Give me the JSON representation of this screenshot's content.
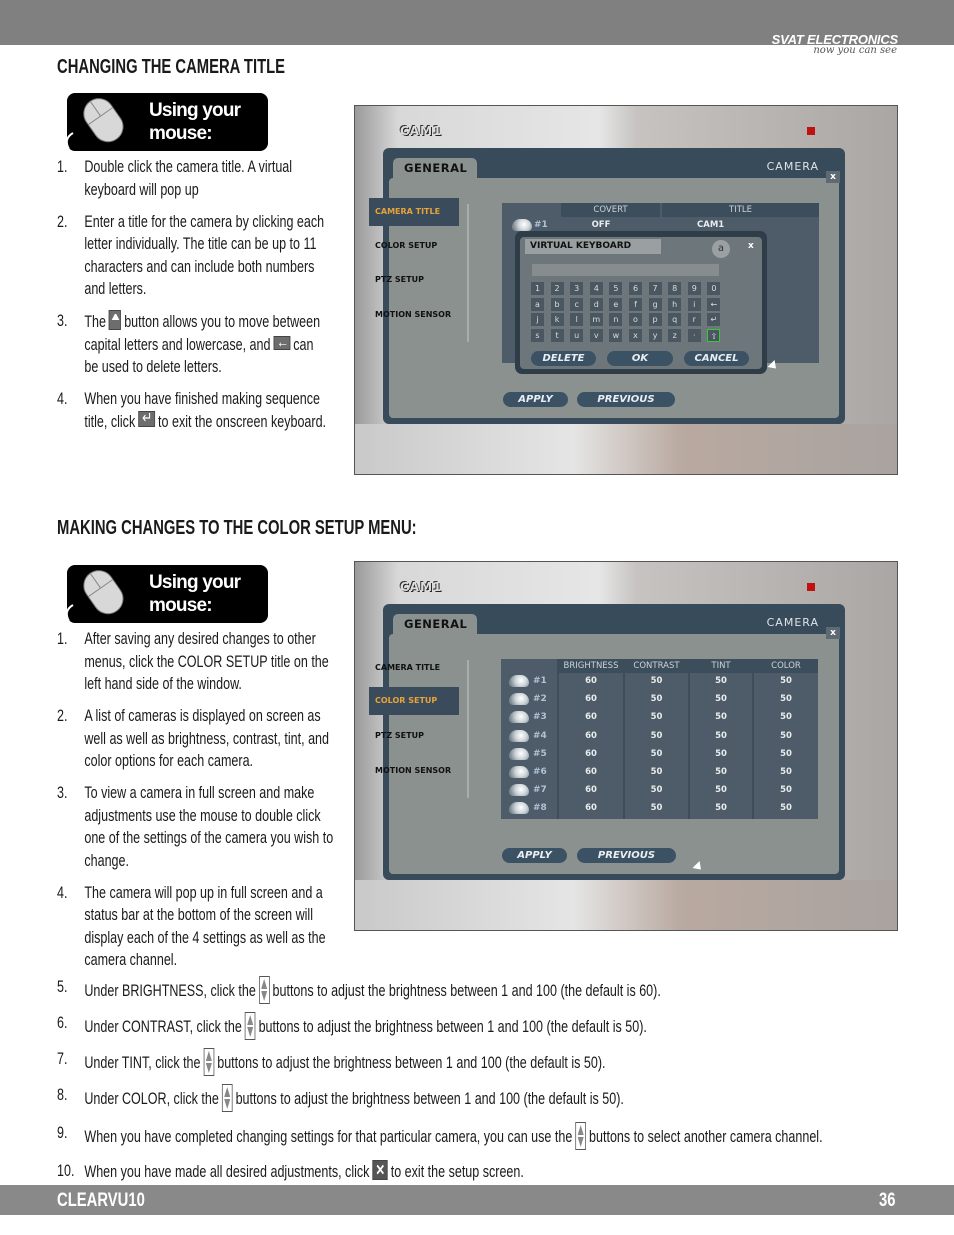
{
  "header": {
    "brand": "SVAT ELECTRONICS",
    "tagline": "now you can see"
  },
  "footer": {
    "product": "CLEARVU10",
    "page": "36"
  },
  "section1": {
    "title": "CHANGING THE CAMERA TITLE",
    "badge": [
      "Using your",
      "mouse:"
    ],
    "items": [
      {
        "num": "1.",
        "before": "Double click the camera title.  A virtual keyboard will pop up"
      },
      {
        "num": "2.",
        "before": "Enter a title for the camera by clicking each letter individually.  The title can be up to 11 characters and can include both numbers and letters."
      },
      {
        "num": "3.",
        "before": "The",
        "icon": "shift-up-icon",
        "after": "button allows you to move between capital letters and lowercase, and",
        "icon2": "backspace-icon",
        "after2": "can be used to delete letters."
      },
      {
        "num": "4.",
        "before": "When you have finished making sequence title, click",
        "icon": "enter-icon",
        "after": "to exit the onscreen keyboard."
      }
    ]
  },
  "section2": {
    "title": "MAKING CHANGES TO THE COLOR SETUP MENU:",
    "badge": [
      "Using your",
      "mouse:"
    ],
    "items": [
      {
        "num": "1.",
        "before": "After saving any desired changes to other menus, click the COLOR SETUP title on the left hand side of the window."
      },
      {
        "num": "2.",
        "before": "A list of cameras is displayed on screen as well as well as brightness, contrast, tint, and color options for each camera."
      },
      {
        "num": "3.",
        "before": "To view a camera in full screen and make adjustments use the mouse to double click one of the settings of the camera you wish to change."
      },
      {
        "num": "4.",
        "before": "The camera will pop up in full screen and a status bar at the bottom of the screen will display each of the 4 settings as well as the camera channel."
      }
    ],
    "wide_items": [
      {
        "num": "5.",
        "before": "Under BRIGHTNESS, click the",
        "icon": "up-down-stepper-icon",
        "after": "buttons to adjust the brightness between 1 and 100 (the default is 60)."
      },
      {
        "num": "6.",
        "before": "Under CONTRAST, click the",
        "icon": "up-down-stepper-icon",
        "after": "buttons to adjust the brightness between 1 and 100 (the default is 50)."
      },
      {
        "num": "7.",
        "before": "Under TINT, click the",
        "icon": "up-down-stepper-icon",
        "after": "buttons to adjust the brightness between 1 and 100 (the default is 50)."
      },
      {
        "num": "8.",
        "before": "Under COLOR, click the",
        "icon": "up-down-stepper-icon",
        "after": "buttons to adjust the brightness between 1 and 100 (the default is 50)."
      },
      {
        "num": "9.",
        "before": "When you have completed changing settings for that particular camera, you can use the",
        "icon": "up-down-stepper-icon",
        "after": "buttons to select another camera channel."
      },
      {
        "num": "10.",
        "before": "When you have made all desired adjustments, click",
        "icon": "close-x-icon",
        "after": "to exit the setup screen."
      }
    ]
  },
  "dvr": {
    "cam_label": "CAM1",
    "tab": "GENERAL",
    "section": "CAMERA",
    "close": "x",
    "side": [
      "CAMERA TITLE",
      "COLOR SETUP",
      "PTZ SETUP",
      "MOTION SENSOR"
    ],
    "apply": "APPLY",
    "previous": "PREVIOUS",
    "accent": "#e7a33a",
    "title_table": {
      "headers": [
        "COVERT",
        "TITLE"
      ],
      "row": {
        "cam": "#1",
        "covert": "OFF",
        "title": "CAM1"
      }
    },
    "keyboard": {
      "title": "VIRTUAL KEYBOARD",
      "case_key": "a",
      "close": "x",
      "keys": [
        [
          "1",
          "2",
          "3",
          "4",
          "5",
          "6",
          "7",
          "8",
          "9",
          "0"
        ],
        [
          "a",
          "b",
          "c",
          "d",
          "e",
          "f",
          "g",
          "h",
          "i",
          "←"
        ],
        [
          "j",
          "k",
          "l",
          "m",
          "n",
          "o",
          "p",
          "q",
          "r",
          "↵"
        ],
        [
          "s",
          "t",
          "u",
          "v",
          "w",
          "x",
          "y",
          "z",
          "·",
          "⇧"
        ]
      ],
      "delete": "DELETE",
      "ok": "OK",
      "cancel": "CANCEL"
    },
    "color_table": {
      "headers": [
        "BRIGHTNESS",
        "CONTRAST",
        "TINT",
        "COLOR"
      ],
      "rows": [
        [
          "#1",
          "60",
          "50",
          "50",
          "50"
        ],
        [
          "#2",
          "60",
          "50",
          "50",
          "50"
        ],
        [
          "#3",
          "60",
          "50",
          "50",
          "50"
        ],
        [
          "#4",
          "60",
          "50",
          "50",
          "50"
        ],
        [
          "#5",
          "60",
          "50",
          "50",
          "50"
        ],
        [
          "#6",
          "60",
          "50",
          "50",
          "50"
        ],
        [
          "#7",
          "60",
          "50",
          "50",
          "50"
        ],
        [
          "#8",
          "60",
          "50",
          "50",
          "50"
        ]
      ]
    }
  }
}
